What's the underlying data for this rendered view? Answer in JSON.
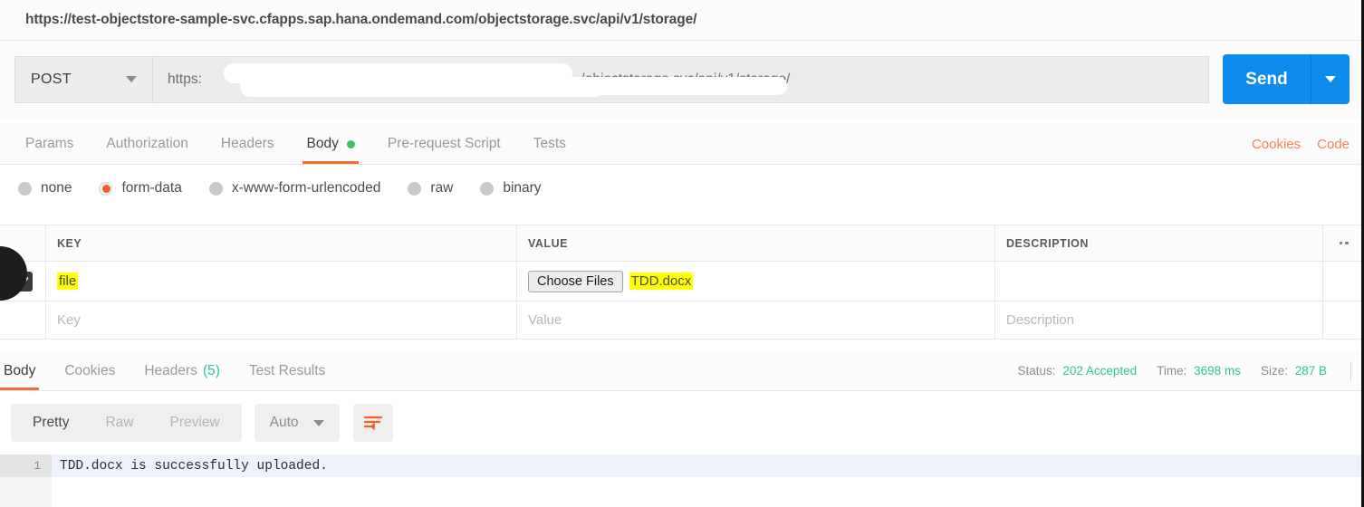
{
  "url_strip": {
    "url": "https://test-objectstore-sample-svc.cfapps.sap.hana.ondemand.com/objectstorage.svc/api/v1/storage/"
  },
  "request_bar": {
    "method": "POST",
    "url_prefix": "https:",
    "url_suffix": "/objectstorage.svc/api/v1/storage/",
    "send_label": "Send"
  },
  "request_tabs": {
    "items": [
      {
        "label": "Params",
        "active": false,
        "has_dot": false
      },
      {
        "label": "Authorization",
        "active": false,
        "has_dot": false
      },
      {
        "label": "Headers",
        "active": false,
        "has_dot": false
      },
      {
        "label": "Body",
        "active": true,
        "has_dot": true
      },
      {
        "label": "Pre-request Script",
        "active": false,
        "has_dot": false
      },
      {
        "label": "Tests",
        "active": false,
        "has_dot": false
      }
    ],
    "links": [
      {
        "label": "Cookies"
      },
      {
        "label": "Code"
      }
    ]
  },
  "body_type": {
    "options": [
      {
        "label": "none",
        "selected": false
      },
      {
        "label": "form-data",
        "selected": true
      },
      {
        "label": "x-www-form-urlencoded",
        "selected": false
      },
      {
        "label": "raw",
        "selected": false
      },
      {
        "label": "binary",
        "selected": false
      }
    ]
  },
  "form_table": {
    "headers": {
      "key": "KEY",
      "value": "VALUE",
      "description": "DESCRIPTION"
    },
    "rows": [
      {
        "checked": true,
        "key": "file",
        "key_highlighted": true,
        "value_button": "Choose Files",
        "value_file": "TDD.docx",
        "value_highlighted": true,
        "description": ""
      }
    ],
    "placeholder_row": {
      "key": "Key",
      "value": "Value",
      "description": "Description"
    }
  },
  "response_tabs": {
    "items": [
      {
        "label": "Body",
        "active": true,
        "count": ""
      },
      {
        "label": "Cookies",
        "active": false,
        "count": ""
      },
      {
        "label": "Headers",
        "active": false,
        "count": "(5)"
      },
      {
        "label": "Test Results",
        "active": false,
        "count": ""
      }
    ],
    "stats": [
      {
        "key": "Status:",
        "value": "202 Accepted"
      },
      {
        "key": "Time:",
        "value": "3698 ms"
      },
      {
        "key": "Size:",
        "value": "287 B"
      }
    ]
  },
  "response_toolbar": {
    "view_modes": [
      {
        "label": "Pretty",
        "active": true
      },
      {
        "label": "Raw",
        "active": false
      },
      {
        "label": "Preview",
        "active": false
      }
    ],
    "format": "Auto",
    "wrap_icon": "word-wrap-icon"
  },
  "response_body": {
    "line_number": "1",
    "text": "TDD.docx is successfully uploaded."
  },
  "colors": {
    "accent_orange": "#f26b3a",
    "send_blue": "#0d8ced",
    "status_green": "#2fc98a",
    "highlight_yellow": "#ffff00",
    "link_orange": "#f8825a"
  }
}
